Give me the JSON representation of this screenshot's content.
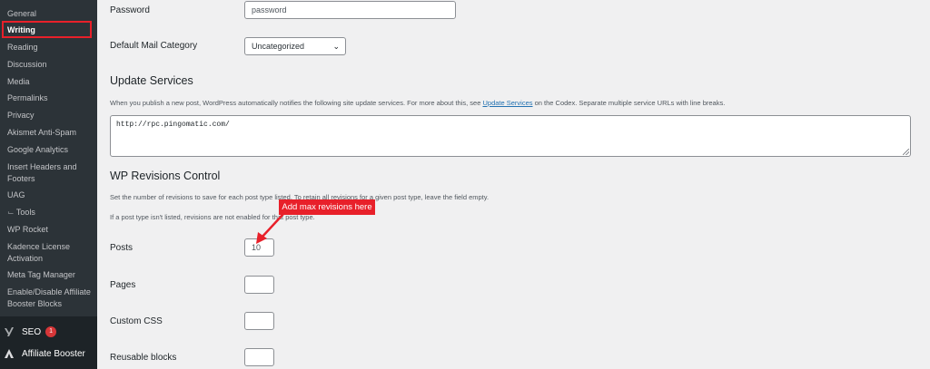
{
  "sidebar": {
    "items": [
      {
        "label": "General"
      },
      {
        "label": "Writing"
      },
      {
        "label": "Reading"
      },
      {
        "label": "Discussion"
      },
      {
        "label": "Media"
      },
      {
        "label": "Permalinks"
      },
      {
        "label": "Privacy"
      },
      {
        "label": "Akismet Anti-Spam"
      },
      {
        "label": "Google Analytics"
      },
      {
        "label": "Insert Headers and Footers"
      },
      {
        "label": "UAG"
      },
      {
        "label": "Tools"
      },
      {
        "label": "WP Rocket"
      },
      {
        "label": "Kadence License Activation"
      },
      {
        "label": "Meta Tag Manager"
      },
      {
        "label": "Enable/Disable Affiliate Booster Blocks"
      }
    ],
    "bottom": [
      {
        "label": "SEO",
        "badge": "1",
        "icon": "yoast-icon"
      },
      {
        "label": "Affiliate Booster",
        "icon": "affiliate-booster-icon"
      }
    ]
  },
  "form": {
    "password_label": "Password",
    "password_value": "password",
    "mail_category_label": "Default Mail Category",
    "mail_category_value": "Uncategorized",
    "update_services_heading": "Update Services",
    "update_services_desc_pre": "When you publish a new post, WordPress automatically notifies the following site update services. For more about this, see ",
    "update_services_link": "Update Services",
    "update_services_desc_post": " on the Codex. Separate multiple service URLs with line breaks.",
    "ping_urls": "http://rpc.pingomatic.com/",
    "revisions_heading": "WP Revisions Control",
    "revisions_desc1": "Set the number of revisions to save for each post type listed. To retain all revisions for a given post type, leave the field empty.",
    "revisions_desc2": "If a post type isn't listed, revisions are not enabled for that post type.",
    "post_types": [
      {
        "label": "Posts",
        "value": "10"
      },
      {
        "label": "Pages",
        "value": ""
      },
      {
        "label": "Custom CSS",
        "value": ""
      },
      {
        "label": "Reusable blocks",
        "value": ""
      }
    ]
  },
  "annotation": {
    "callout": "Add max revisions here"
  },
  "colors": {
    "accent_red": "#e8202a",
    "sidebar_bg": "#2c3338",
    "link": "#2271b1"
  }
}
